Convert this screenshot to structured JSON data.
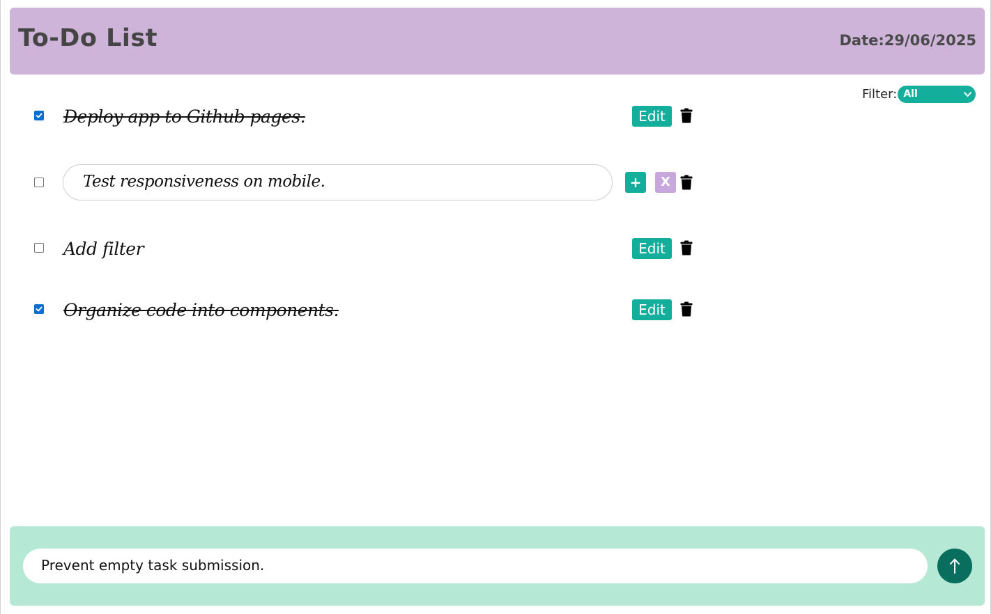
{
  "header": {
    "title": "To-Do List",
    "date_text": "Date:29/06/2025"
  },
  "filter": {
    "label": "Filter:",
    "selected": "All"
  },
  "tasks": [
    {
      "text": "Deploy app to Github pages.",
      "completed": true,
      "editing": false,
      "edit_label": "Edit"
    },
    {
      "text": "Test responsiveness on mobile.",
      "completed": false,
      "editing": true,
      "save_label": "+",
      "cancel_label": "X"
    },
    {
      "text": "Add filter",
      "completed": false,
      "editing": false,
      "edit_label": "Edit"
    },
    {
      "text": "Organize code into components.",
      "completed": true,
      "editing": false,
      "edit_label": "Edit"
    }
  ],
  "composer": {
    "value": "Prevent empty task submission.",
    "submit_icon": "arrow-up-icon"
  },
  "colors": {
    "header_bg": "#cfb4da",
    "accent": "#13ae9c",
    "cancel": "#c8a7dc",
    "footer_bg": "#b5e9d6",
    "submit_bg": "#0a6e5e",
    "checkbox_checked": "#0a6fd1"
  }
}
